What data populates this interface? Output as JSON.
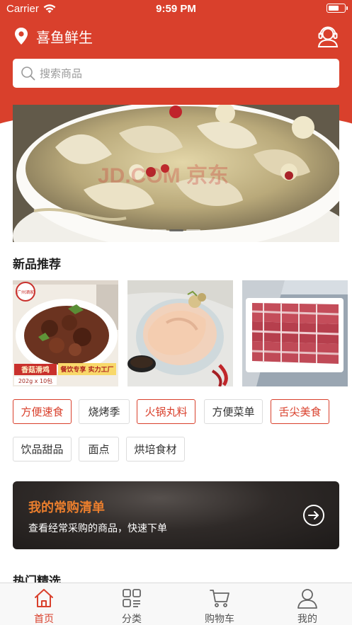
{
  "status_bar": {
    "carrier": "Carrier",
    "time": "9:59 PM"
  },
  "header": {
    "store_name": "喜鱼鲜生"
  },
  "search": {
    "placeholder": "搜索商品"
  },
  "banner": {
    "watermark": "JD.COM 京东",
    "slide_count": 3,
    "active_slide": 2
  },
  "new_products": {
    "title": "新品推荐",
    "items": [
      {
        "name": "香菇滑鸡",
        "spec": "202g x 10包",
        "caption": "餐饮专享 实力工厂",
        "brand": "广州酒家"
      },
      {
        "name": "chicken"
      },
      {
        "name": "ribs"
      }
    ]
  },
  "tags": [
    {
      "label": "方便速食",
      "highlight": true
    },
    {
      "label": "烧烤季",
      "highlight": false
    },
    {
      "label": "火锅丸料",
      "highlight": true
    },
    {
      "label": "方便菜单",
      "highlight": false
    },
    {
      "label": "舌尖美食",
      "highlight": true
    },
    {
      "label": "饮品甜品",
      "highlight": false
    },
    {
      "label": "面点",
      "highlight": false
    },
    {
      "label": "烘培食材",
      "highlight": false
    }
  ],
  "promo": {
    "title": "我的常购清单",
    "subtitle": "查看经常采购的商品，快速下单"
  },
  "hot": {
    "title": "热门精选"
  },
  "tabbar": {
    "tabs": [
      {
        "label": "首页",
        "icon": "home-icon",
        "active": true
      },
      {
        "label": "分类",
        "icon": "grid-icon",
        "active": false
      },
      {
        "label": "购物车",
        "icon": "cart-icon",
        "active": false
      },
      {
        "label": "我的",
        "icon": "user-icon",
        "active": false
      }
    ]
  },
  "colors": {
    "brand": "#d9402c",
    "promo_accent": "#ea7e2d",
    "tag_border": "#dcdcdc"
  }
}
